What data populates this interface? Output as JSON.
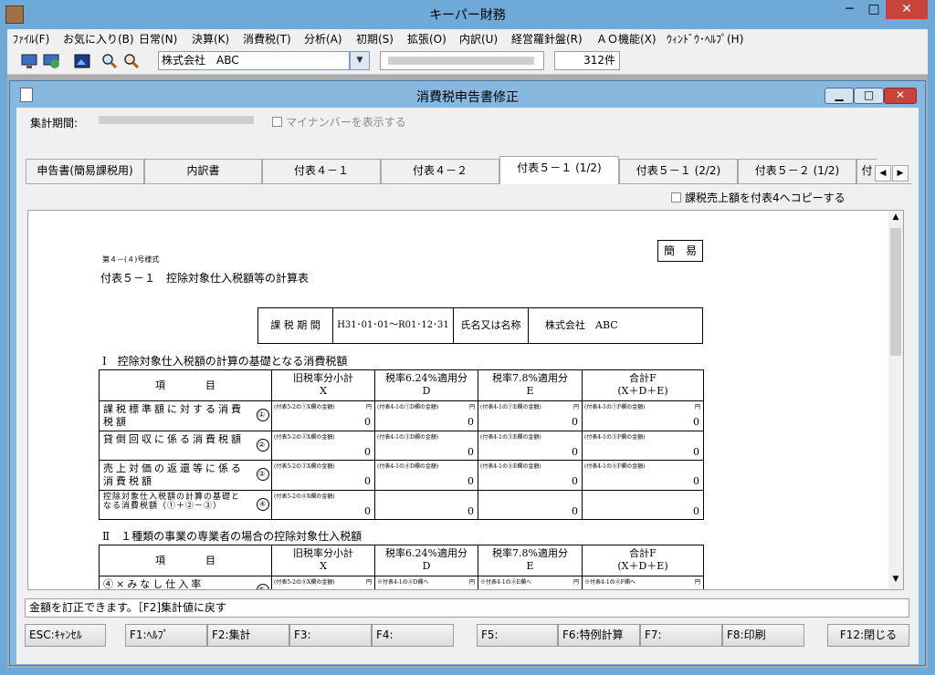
{
  "window": {
    "title": "キーパー財務",
    "min": "─",
    "max": "□",
    "close": "✕"
  },
  "menu": [
    "ﾌｧｲﾙ(F)",
    "お気に入り(B)",
    "日常(N)",
    "決算(K)",
    "消費税(T)",
    "分析(A)",
    "初期(S)",
    "拡張(O)",
    "内訳(U)",
    "経営羅針盤(R)",
    "ＡＯ機能(X)",
    "ｳｨﾝﾄﾞｳ･ﾍﾙﾌﾟ(H)"
  ],
  "toolbar": {
    "company": "株式会社　ABC",
    "count": "312件"
  },
  "child": {
    "title": "消費税申告書修正"
  },
  "period": {
    "label": "集計期間:",
    "mynumber": "マイナンバーを表示する"
  },
  "tabs": [
    "申告書(簡易課税用)",
    "内訳書",
    "付表４－１",
    "付表４－２",
    "付表５－１ (1/2)",
    "付表５－１ (2/2)",
    "付表５－２ (1/2)",
    "付"
  ],
  "active_tab": 4,
  "copy_checkbox": "課税売上額を付表4へコピーする",
  "doc": {
    "form_no": "第４－(４)号様式",
    "title": "付表５－１　控除対象仕入税額等の計算表",
    "kani": "簡　易",
    "period_label": "課 税 期 間",
    "period_value": "H31･01･01～R01･12･31",
    "name_label": "氏名又は名称",
    "name_value": "株式会社　ABC",
    "section1": "Ⅰ　控除対象仕入税額の計算の基礎となる消費税額",
    "section2": "Ⅱ　１種類の事業の専業者の場合の控除対象仕入税額",
    "col_item": "項　　　　目",
    "col_x": "旧税率分小計",
    "col_x_sub": "X",
    "col_d": "税率6.24%適用分",
    "col_d_sub": "D",
    "col_e": "税率7.8%適用分",
    "col_e_sub": "E",
    "col_f": "合計F",
    "col_f_sub": "(X＋D＋E)",
    "rows": [
      {
        "label": "課税標準額に対する消費税額",
        "num": "①",
        "notes": [
          "(付表5-2の①X欄の金額)",
          "(付表4-1の①D欄の金額)",
          "(付表4-1の①E欄の金額)",
          "(付表4-1の①F欄の金額)"
        ],
        "values": [
          "0",
          "0",
          "0",
          "0"
        ]
      },
      {
        "label": "貸倒回収に係る消費税額",
        "num": "②",
        "notes": [
          "(付表5-2の②X欄の金額)",
          "(付表4-1の③D欄の金額)",
          "(付表4-1の③E欄の金額)",
          "(付表4-1の③F欄の金額)"
        ],
        "values": [
          "0",
          "0",
          "0",
          "0"
        ]
      },
      {
        "label": "売上対価の返還等に係る消費税額",
        "num": "③",
        "notes": [
          "(付表5-2の③X欄の金額)",
          "(付表4-1の⑤D欄の金額)",
          "(付表4-1の⑤E欄の金額)",
          "(付表4-1の⑤F欄の金額)"
        ],
        "values": [
          "0",
          "0",
          "0",
          "0"
        ]
      },
      {
        "label": "控除対象仕入税額の計算の基礎となる消費税額（①＋②－③）",
        "num": "④",
        "notes": [
          "(付表5-2の④X欄の金額)",
          "",
          "",
          ""
        ],
        "values": [
          "0",
          "0",
          "0",
          "0"
        ]
      }
    ],
    "row2": {
      "label": "④×みなし仕入率",
      "num": "⑤",
      "notes": [
        "(付表5-2の⑤X欄の金額)",
        "※付表4-1の④D欄へ",
        "※付表4-1の④E欄へ",
        "※付表4-1の④F欄へ"
      ]
    },
    "yen": "円"
  },
  "status_message": "金額を訂正できます。［F2]集計値に戻す",
  "fkeys": [
    "ESC:ｷｬﾝｾﾙ",
    "F1:ﾍﾙﾌﾟ",
    "F2:集計",
    "F3:",
    "F4:",
    "F5:",
    "F6:特例計算",
    "F7:",
    "F8:印刷",
    "F12:閉じる"
  ]
}
